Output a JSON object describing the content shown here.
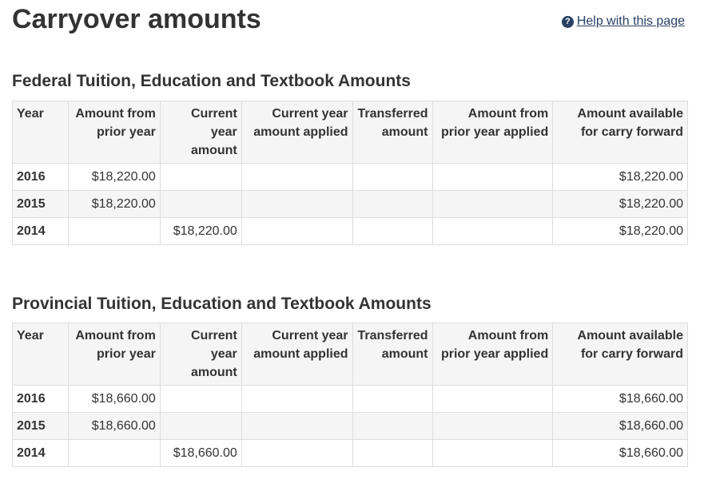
{
  "page_title": "Carryover amounts",
  "help_link": {
    "icon": "question-circle-icon",
    "label": "Help with this page"
  },
  "columns": [
    "Year",
    "Amount from prior year",
    "Current year amount",
    "Current year amount applied",
    "Transferred amount",
    "Amount from prior year applied",
    "Amount available for carry forward"
  ],
  "federal": {
    "title": "Federal Tuition, Education and Textbook Amounts",
    "rows": [
      {
        "year": "2016",
        "prior": "$18,220.00",
        "current": "",
        "applied": "",
        "transferred": "",
        "prior_applied": "",
        "available": "$18,220.00"
      },
      {
        "year": "2015",
        "prior": "$18,220.00",
        "current": "",
        "applied": "",
        "transferred": "",
        "prior_applied": "",
        "available": "$18,220.00"
      },
      {
        "year": "2014",
        "prior": "",
        "current": "$18,220.00",
        "applied": "",
        "transferred": "",
        "prior_applied": "",
        "available": "$18,220.00"
      }
    ]
  },
  "provincial": {
    "title": "Provincial Tuition, Education and Textbook Amounts",
    "rows": [
      {
        "year": "2016",
        "prior": "$18,660.00",
        "current": "",
        "applied": "",
        "transferred": "",
        "prior_applied": "",
        "available": "$18,660.00"
      },
      {
        "year": "2015",
        "prior": "$18,660.00",
        "current": "",
        "applied": "",
        "transferred": "",
        "prior_applied": "",
        "available": "$18,660.00"
      },
      {
        "year": "2014",
        "prior": "",
        "current": "$18,660.00",
        "applied": "",
        "transferred": "",
        "prior_applied": "",
        "available": "$18,660.00"
      }
    ]
  }
}
